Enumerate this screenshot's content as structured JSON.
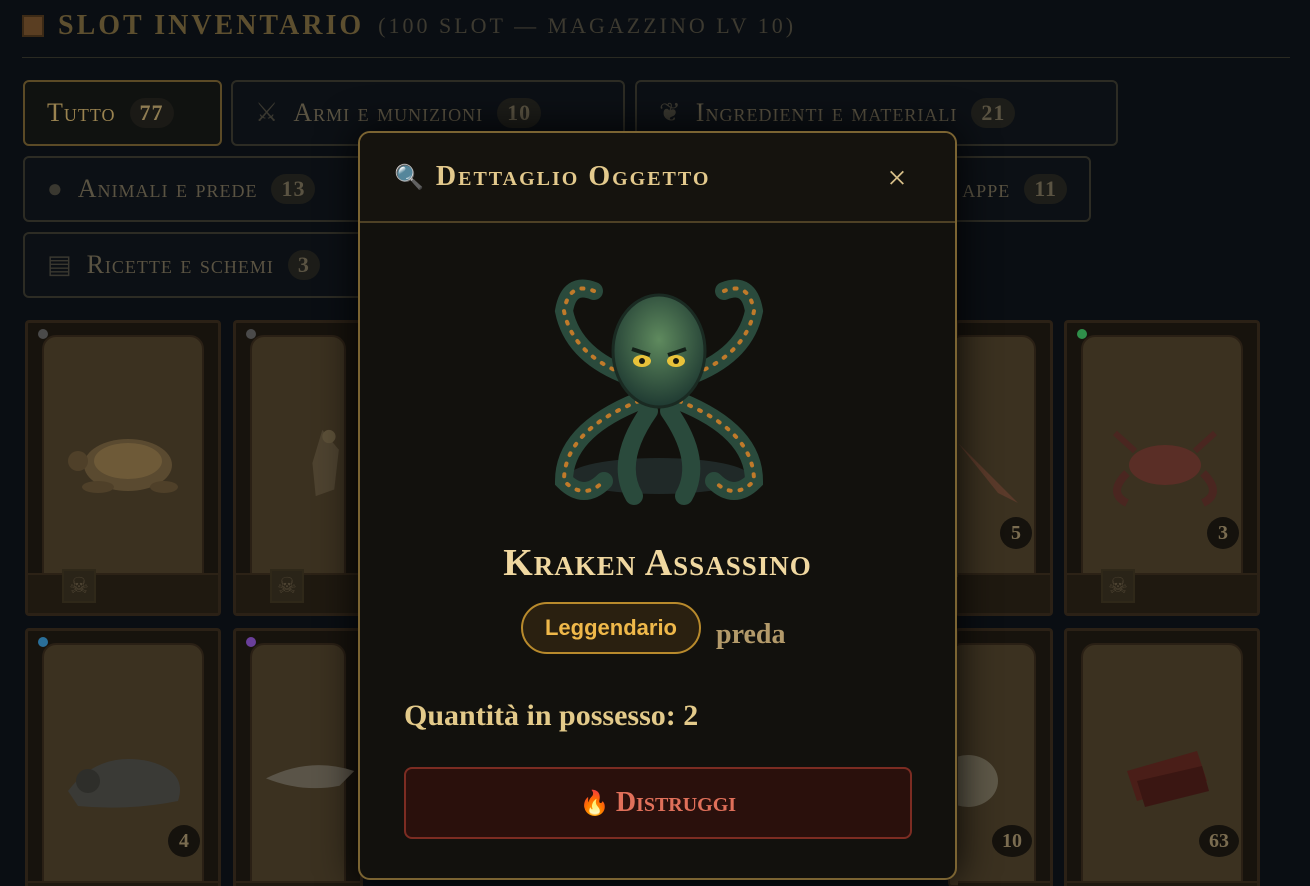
{
  "header": {
    "title": "SLOT INVENTARIO",
    "subtitle": "(100 SLOT — MAGAZZINO LV 10)",
    "icon": "crate-icon"
  },
  "filters": [
    {
      "label": "Tutto",
      "count": "77",
      "icon": "",
      "active": true
    },
    {
      "label": "Armi e munizioni",
      "count": "10",
      "icon": "crossed-swords-icon"
    },
    {
      "label": "Ingredienti e materiali",
      "count": "21",
      "icon": "herb-icon"
    },
    {
      "label": "Animali e prede",
      "count": "13",
      "icon": "boar-icon"
    },
    {
      "label": "appe",
      "count": "11",
      "icon": ""
    },
    {
      "label": "Ricette e schemi",
      "count": "3",
      "icon": "scroll-icon"
    }
  ],
  "cards": [
    {
      "name": "tartaruga",
      "qty": "",
      "skull": true,
      "gem": "#3a3a3a"
    },
    {
      "name": "falco",
      "qty": "",
      "skull": true,
      "gem": "#3a3a3a"
    },
    {
      "name": "uccello",
      "qty": "5",
      "skull": false,
      "gem": "#3a3a3a"
    },
    {
      "name": "granchio",
      "qty": "3",
      "skull": true,
      "gem": "#2f8f4a"
    },
    {
      "name": "iguana",
      "qty": "4",
      "skull": false,
      "gem": "#2a6f9a"
    },
    {
      "name": "squalo",
      "qty": "",
      "skull": false,
      "gem": "#6a3f9a"
    },
    {
      "name": "ciotola",
      "qty": "10",
      "skull": false,
      "gem": "#3a3a3a"
    },
    {
      "name": "carne essiccata",
      "qty": "63",
      "skull": false,
      "gem": "#3a3a3a"
    }
  ],
  "modal": {
    "title": "Dettaglio Oggetto",
    "title_icon": "magnifier-icon",
    "close_glyph": "×",
    "item_name": "Kraken Assassino",
    "rarity": "Leggendario",
    "rarity_color": "#efb84a",
    "category": "preda",
    "quantity_text": "Quantità in possesso: 2",
    "destroy_label": "Distruggi",
    "destroy_icon": "fire-icon"
  },
  "colors": {
    "gold": "#e3c98c",
    "danger": "#e0705a",
    "background": "#0a0e13"
  }
}
